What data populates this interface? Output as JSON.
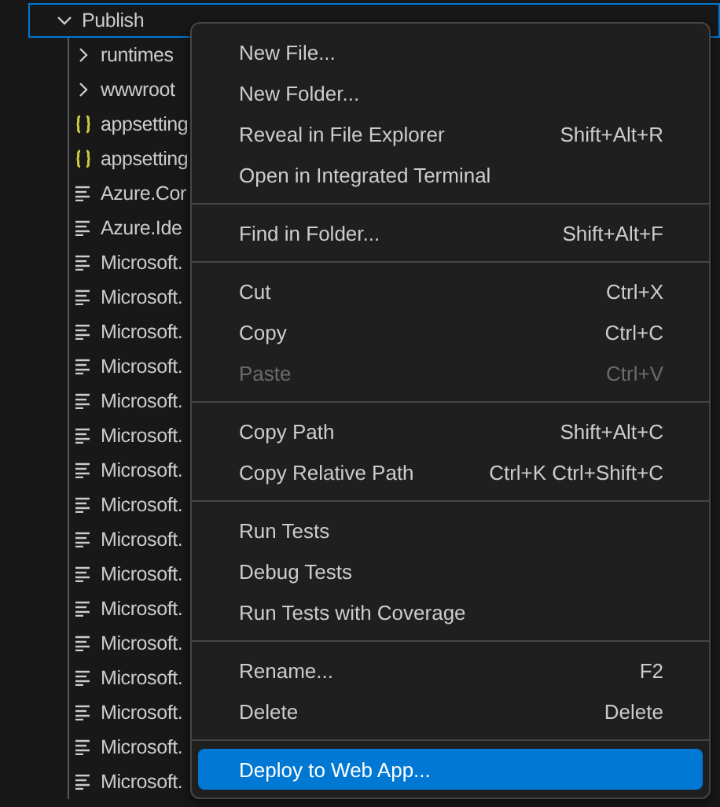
{
  "tree": {
    "label": "Publish",
    "expanded": true,
    "focused": true,
    "children": [
      {
        "kind": "folder",
        "label": "runtimes",
        "expanded": false
      },
      {
        "kind": "folder",
        "label": "wwwroot",
        "expanded": false
      },
      {
        "kind": "json",
        "label": "appsetting"
      },
      {
        "kind": "json",
        "label": "appsetting"
      },
      {
        "kind": "file",
        "label": "Azure.Cor"
      },
      {
        "kind": "file",
        "label": "Azure.Ide"
      },
      {
        "kind": "file",
        "label": "Microsoft."
      },
      {
        "kind": "file",
        "label": "Microsoft."
      },
      {
        "kind": "file",
        "label": "Microsoft."
      },
      {
        "kind": "file",
        "label": "Microsoft."
      },
      {
        "kind": "file",
        "label": "Microsoft."
      },
      {
        "kind": "file",
        "label": "Microsoft."
      },
      {
        "kind": "file",
        "label": "Microsoft."
      },
      {
        "kind": "file",
        "label": "Microsoft."
      },
      {
        "kind": "file",
        "label": "Microsoft."
      },
      {
        "kind": "file",
        "label": "Microsoft."
      },
      {
        "kind": "file",
        "label": "Microsoft."
      },
      {
        "kind": "file",
        "label": "Microsoft."
      },
      {
        "kind": "file",
        "label": "Microsoft."
      },
      {
        "kind": "file",
        "label": "Microsoft."
      },
      {
        "kind": "file",
        "label": "Microsoft."
      },
      {
        "kind": "file",
        "label": "Microsoft."
      }
    ]
  },
  "context_menu": [
    {
      "kind": "item",
      "label": "New File...",
      "disabled": false,
      "selected": false
    },
    {
      "kind": "item",
      "label": "New Folder...",
      "disabled": false,
      "selected": false
    },
    {
      "kind": "item",
      "label": "Reveal in File Explorer",
      "shortcut": "Shift+Alt+R",
      "disabled": false,
      "selected": false
    },
    {
      "kind": "item",
      "label": "Open in Integrated Terminal",
      "disabled": false,
      "selected": false
    },
    {
      "kind": "separator"
    },
    {
      "kind": "item",
      "label": "Find in Folder...",
      "shortcut": "Shift+Alt+F",
      "disabled": false,
      "selected": false
    },
    {
      "kind": "separator"
    },
    {
      "kind": "item",
      "label": "Cut",
      "shortcut": "Ctrl+X",
      "disabled": false,
      "selected": false
    },
    {
      "kind": "item",
      "label": "Copy",
      "shortcut": "Ctrl+C",
      "disabled": false,
      "selected": false
    },
    {
      "kind": "item",
      "label": "Paste",
      "shortcut": "Ctrl+V",
      "disabled": true,
      "selected": false
    },
    {
      "kind": "separator"
    },
    {
      "kind": "item",
      "label": "Copy Path",
      "shortcut": "Shift+Alt+C",
      "disabled": false,
      "selected": false
    },
    {
      "kind": "item",
      "label": "Copy Relative Path",
      "shortcut": "Ctrl+K Ctrl+Shift+C",
      "disabled": false,
      "selected": false
    },
    {
      "kind": "separator"
    },
    {
      "kind": "item",
      "label": "Run Tests",
      "disabled": false,
      "selected": false
    },
    {
      "kind": "item",
      "label": "Debug Tests",
      "disabled": false,
      "selected": false
    },
    {
      "kind": "item",
      "label": "Run Tests with Coverage",
      "disabled": false,
      "selected": false
    },
    {
      "kind": "separator"
    },
    {
      "kind": "item",
      "label": "Rename...",
      "shortcut": "F2",
      "disabled": false,
      "selected": false
    },
    {
      "kind": "item",
      "label": "Delete",
      "shortcut": "Delete",
      "disabled": false,
      "selected": false
    },
    {
      "kind": "separator"
    },
    {
      "kind": "item",
      "label": "Deploy to Web App...",
      "disabled": false,
      "selected": true
    }
  ]
}
